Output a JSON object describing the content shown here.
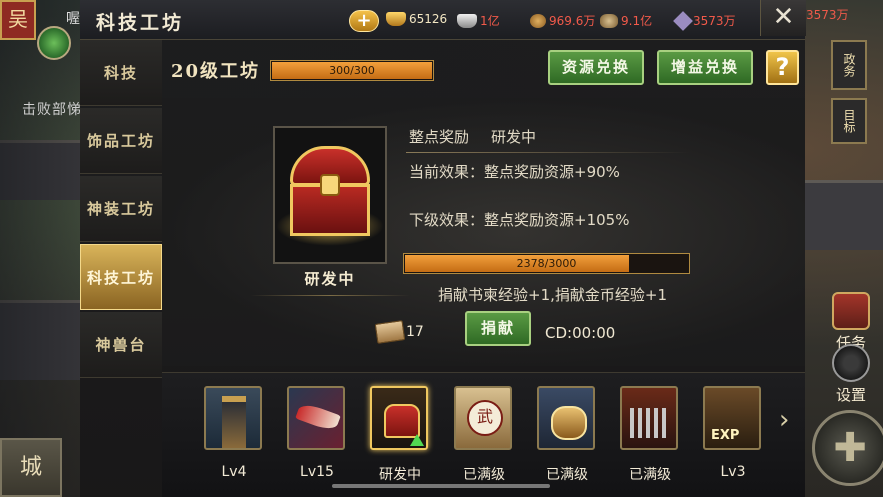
{
  "header": {
    "title": "科技工坊",
    "close_label": "✕",
    "plus_label": "+",
    "resources": [
      {
        "icon": "gold-ingot-icon",
        "value": "65126",
        "color": "#f3e7c4"
      },
      {
        "icon": "silver-ingot-icon",
        "value": "1亿",
        "color": "#f25a4a"
      },
      {
        "icon": "food-icon",
        "value": "969.6万",
        "color": "#f25a4a"
      },
      {
        "icon": "wood-icon",
        "value": "9.1亿",
        "color": "#f25a4a"
      },
      {
        "icon": "gem-icon",
        "value": "3573万",
        "color": "#f25a4a"
      }
    ]
  },
  "background": {
    "faction_badge": "吴",
    "peek_text": "喔",
    "defeat_text": "击败部悌",
    "city_label": "城",
    "top_right_value": "3573万",
    "side_buttons": {
      "zhengwu": "政务",
      "mubiao": "目标",
      "task": "任务",
      "settings": "设置"
    }
  },
  "tabs": [
    {
      "label": "科技",
      "active": false
    },
    {
      "label": "饰品工坊",
      "active": false
    },
    {
      "label": "神装工坊",
      "active": false
    },
    {
      "label": "科技工坊",
      "active": true
    },
    {
      "label": "神兽台",
      "active": false
    }
  ],
  "level": {
    "label": "20级工坊",
    "progress_text": "300/300",
    "progress": 1.0
  },
  "actions": {
    "resource_exchange": "资源兑换",
    "gain_exchange": "增益兑换",
    "help": "?"
  },
  "detail": {
    "name": "整点奖励",
    "status": "研发中",
    "current_effect": "当前效果：整点奖励资源+90%",
    "next_effect": "下级效果：整点奖励资源+105%",
    "chest_status": "研发中",
    "progress_text": "2378/3000",
    "progress": 0.7927,
    "donate_info": "捐献书柬经验+1,捐献金币经验+1",
    "book_count": "17",
    "donate_button": "捐献",
    "cd": "CD:00:00"
  },
  "items": [
    {
      "name": "tower-item",
      "art": "art-tower",
      "label": "Lv4",
      "selected": false
    },
    {
      "name": "blade-item",
      "art": "art-blade",
      "label": "Lv15",
      "selected": false
    },
    {
      "name": "chest-item",
      "art": "art-chest",
      "label": "研发中",
      "selected": true
    },
    {
      "name": "wu-item",
      "art": "art-wu",
      "label": "已满级",
      "selected": false
    },
    {
      "name": "fist-item",
      "art": "art-fist",
      "label": "已满级",
      "selected": false
    },
    {
      "name": "army-item",
      "art": "art-army",
      "label": "已满级",
      "selected": false
    },
    {
      "name": "exp-item",
      "art": "art-exp",
      "label": "Lv3",
      "selected": false
    }
  ]
}
